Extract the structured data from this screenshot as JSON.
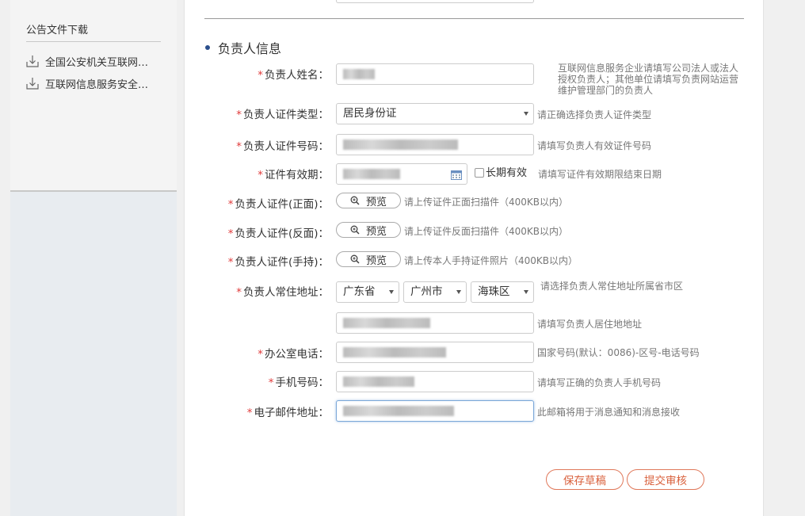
{
  "sidebar": {
    "title": "公告文件下载",
    "items": [
      {
        "label": "全国公安机关互联网…"
      },
      {
        "label": "互联网信息服务安全…"
      }
    ]
  },
  "section": {
    "title": "负责人信息"
  },
  "form": {
    "name": {
      "label": "负责人姓名：",
      "hint": "互联网信息服务企业请填写公司法人或法人授权负责人；其他单位请填写负责网站运营维护管理部门的负责人"
    },
    "id_type": {
      "label": "负责人证件类型：",
      "value": "居民身份证",
      "hint": "请正确选择负责人证件类型"
    },
    "id_number": {
      "label": "负责人证件号码：",
      "hint": "请填写负责人有效证件号码"
    },
    "id_expiry": {
      "label": "证件有效期：",
      "long_term": "长期有效",
      "hint": "请填写证件有效期限结束日期"
    },
    "id_front": {
      "label": "负责人证件(正面)：",
      "button": "预览",
      "hint": "请上传证件正面扫描件（400KB以内）"
    },
    "id_back": {
      "label": "负责人证件(反面)：",
      "button": "预览",
      "hint": "请上传证件反面扫描件（400KB以内）"
    },
    "id_hand": {
      "label": "负责人证件(手持)：",
      "button": "预览",
      "hint": "请上传本人手持证件照片（400KB以内）"
    },
    "address": {
      "label": "负责人常住地址：",
      "province": "广东省",
      "city": "广州市",
      "district": "海珠区",
      "hint": "请选择负责人常住地址所属省市区",
      "detail_hint": "请填写负责人居住地地址"
    },
    "office_phone": {
      "label": "办公室电话：",
      "hint": "国家号码(默认：0086)-区号-电话号码"
    },
    "mobile": {
      "label": "手机号码：",
      "hint": "请填写正确的负责人手机号码"
    },
    "email": {
      "label": "电子邮件地址：",
      "hint": "此邮箱将用于消息通知和消息接收"
    }
  },
  "actions": {
    "save_draft": "保存草稿",
    "submit": "提交审核"
  },
  "required_mark": "*"
}
